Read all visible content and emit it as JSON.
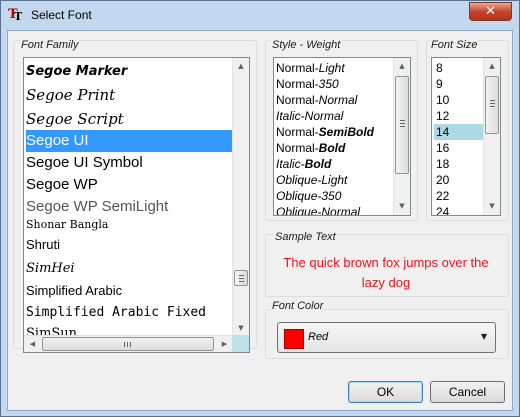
{
  "window": {
    "title": "Select Font",
    "close_glyph": "✕"
  },
  "app_icon": {
    "glyph": "T",
    "icon": "font-app-icon"
  },
  "font_family": {
    "label": "Font Family",
    "items": [
      {
        "label": "Segoe Marker"
      },
      {
        "label": "Segoe Print"
      },
      {
        "label": "Segoe Script"
      },
      {
        "label": "Segoe UI",
        "selected": true
      },
      {
        "label": "Segoe UI Symbol"
      },
      {
        "label": "Segoe WP"
      },
      {
        "label": "Segoe WP SemiLight"
      },
      {
        "label": "Shonar Bangla"
      },
      {
        "label": "Shruti"
      },
      {
        "label": "SimHei"
      },
      {
        "label": "Simplified Arabic"
      },
      {
        "label": "Simplified Arabic Fixed"
      },
      {
        "label": "SimSun"
      }
    ]
  },
  "style_weight": {
    "label": "Style - Weight",
    "items": [
      {
        "label": "Normal-Light"
      },
      {
        "label": "Normal-350"
      },
      {
        "label": "Normal-Normal"
      },
      {
        "label": "Italic-Normal"
      },
      {
        "label": "Normal-SemiBold"
      },
      {
        "label": "Normal-Bold"
      },
      {
        "label": "Italic-Bold"
      },
      {
        "label": "Oblique-Light"
      },
      {
        "label": "Oblique-350"
      },
      {
        "label": "Oblique-Normal"
      }
    ]
  },
  "font_size": {
    "label": "Font Size",
    "items": [
      "8",
      "9",
      "10",
      "12",
      "14",
      "16",
      "18",
      "20",
      "22",
      "24"
    ],
    "selected": "14"
  },
  "sample": {
    "label": "Sample Text",
    "text": "The quick brown fox jumps over the lazy dog",
    "color": "#e8141e"
  },
  "font_color": {
    "label": "Font Color",
    "value": "Red",
    "swatch": "#ff0000"
  },
  "buttons": {
    "ok": "OK",
    "cancel": "Cancel"
  },
  "colors": {
    "selection": "#3399ff",
    "size_selection": "#add8e6",
    "title_bg": "#c3d7ef"
  }
}
